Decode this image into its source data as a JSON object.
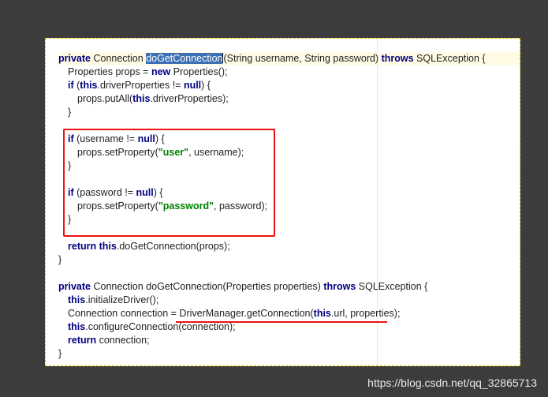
{
  "code": {
    "line1": {
      "kw1": "private",
      "t1": " Connection ",
      "sel": "doGetConnection",
      "t2": "(String username, String password) ",
      "kw2": "throws",
      "t3": " SQLException {"
    },
    "line2": {
      "t1": "Properties props = ",
      "kw1": "new",
      "t2": " Properties();"
    },
    "line3": {
      "kw1": "if",
      "t1": " (",
      "kw2": "this",
      "t2": ".driverProperties != ",
      "kw3": "null",
      "t3": ") {"
    },
    "line4": {
      "t1": "props.putAll(",
      "kw1": "this",
      "t2": ".driverProperties);"
    },
    "line5": {
      "t1": "}"
    },
    "line6": {
      "kw1": "if",
      "t1": " (username != ",
      "kw2": "null",
      "t2": ") {"
    },
    "line7": {
      "t1": "props.setProperty(",
      "str": "\"user\"",
      "t2": ", username);"
    },
    "line8": {
      "t1": "}"
    },
    "line9": {
      "kw1": "if",
      "t1": " (password != ",
      "kw2": "null",
      "t2": ") {"
    },
    "line10": {
      "t1": "props.setProperty(",
      "str": "\"password\"",
      "t2": ", password);"
    },
    "line11": {
      "t1": "}"
    },
    "line12": {
      "kw1": "return",
      "t1": " ",
      "kw2": "this",
      "t2": ".doGetConnection(props);"
    },
    "line13": {
      "t1": "}"
    },
    "line14": {
      "kw1": "private",
      "t1": " Connection doGetConnection(Properties properties) ",
      "kw2": "throws",
      "t2": " SQLException {"
    },
    "line15": {
      "kw1": "this",
      "t1": ".initializeDriver();"
    },
    "line16": {
      "t1": "Connection connection = DriverManager.getConnection(",
      "kw1": "this",
      "t2": ".url, properties);"
    },
    "line17": {
      "kw1": "this",
      "t1": ".configureConnection(connection);"
    },
    "line18": {
      "kw1": "return",
      "t1": " connection;"
    },
    "line19": {
      "t1": "}"
    }
  },
  "watermark": "https://blog.csdn.net/qq_32865713",
  "colors": {
    "keyword": "#000080",
    "string": "#008000",
    "selection": "#3d6fb3",
    "annotation": "#e11111"
  }
}
